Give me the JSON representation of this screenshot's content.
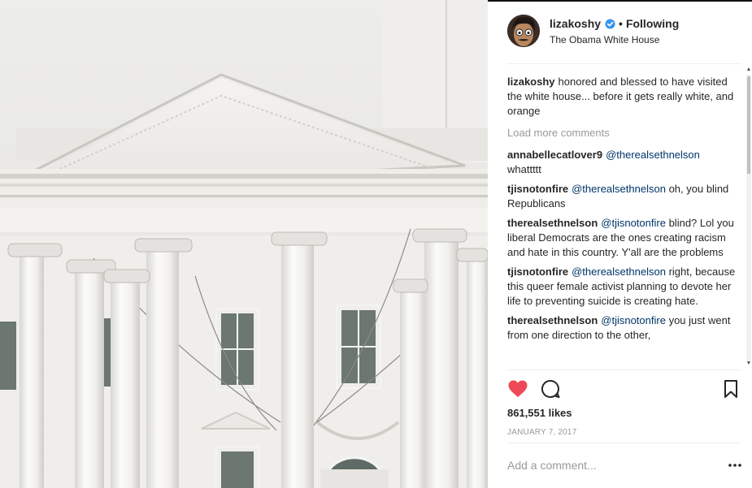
{
  "post": {
    "username": "lizakoshy",
    "verified": true,
    "separator": "•",
    "follow_status": "Following",
    "location": "The Obama White House",
    "image_subject": "The Obama White House",
    "caption": {
      "username": "lizakoshy",
      "text": "honored and blessed to have visited the white house... before it gets really white, and orange"
    },
    "load_more_label": "Load more comments",
    "comments": [
      {
        "username": "annabellecatlover9",
        "mention": "@therealsethnelson",
        "text": "whattttt"
      },
      {
        "username": "tjisnotonfire",
        "mention": "@therealsethnelson",
        "text": "oh, you blind Republicans"
      },
      {
        "username": "therealsethnelson",
        "mention": "@tjisnotonfire",
        "text": "blind? Lol you liberal Democrats are the ones creating racism and hate in this country. Y'all are the problems"
      },
      {
        "username": "tjisnotonfire",
        "mention": "@therealsethnelson",
        "text": "right, because this queer female activist planning to devote her life to preventing suicide is creating hate."
      },
      {
        "username": "therealsethnelson",
        "mention": "@tjisnotonfire",
        "text": "you just went from one direction to the other,"
      }
    ],
    "liked": true,
    "likes_label": "861,551 likes",
    "date": "JANUARY 7, 2017",
    "add_comment_placeholder": "Add a comment...",
    "icons": {
      "like": "heart-icon",
      "comment": "comment-bubble-icon",
      "save": "bookmark-icon",
      "more": "more-options-icon",
      "verified": "verified-badge-icon"
    },
    "colors": {
      "like_red": "#ed4956",
      "verified_blue": "#3897f0",
      "mention_blue": "#003569",
      "muted_gray": "#999999"
    }
  }
}
